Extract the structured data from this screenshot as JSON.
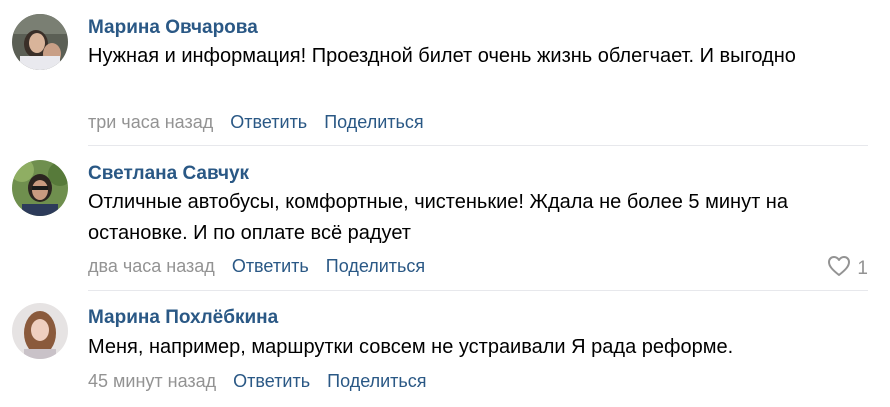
{
  "comments": [
    {
      "author": "Марина Овчарова",
      "text": "Нужная и информация! Проездной билет очень жизнь облегчает. И выгодно",
      "time": "три часа назад",
      "reply_label": "Ответить",
      "share_label": "Поделиться"
    },
    {
      "author": "Светлана Савчук",
      "text": "Отличные автобусы, комфортные, чистенькие! Ждала не более 5 минут на остановке. И по оплате всё радует",
      "time": "два часа назад",
      "reply_label": "Ответить",
      "share_label": "Поделиться",
      "likes": "1"
    },
    {
      "author": "Марина Похлёбкина",
      "text": "Меня, например, маршрутки совсем не устраивали Я рада реформе.",
      "time": "45 минут назад",
      "reply_label": "Ответить",
      "share_label": "Поделиться"
    }
  ],
  "icons": {
    "like": "heart-icon"
  },
  "colors": {
    "link": "#2a5885",
    "muted": "#939393",
    "divider": "#e7e8ec"
  }
}
